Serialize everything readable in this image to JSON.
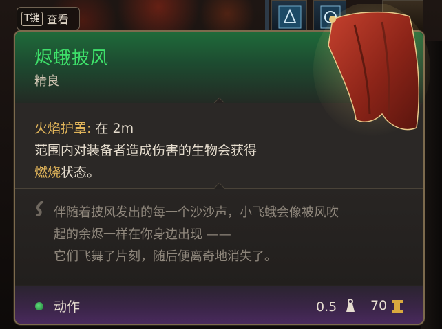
{
  "hotkey": {
    "key": "T键",
    "label": "查看"
  },
  "item": {
    "name": "烬蛾披风",
    "rarity": "精良",
    "property": {
      "name": "火焰护罩:",
      "range": " 在 2m",
      "line2": "范围内对装备者造成伤害的生物会获得",
      "status": "燃烧",
      "line3_rest": "状态。"
    },
    "flavor": [
      "伴随着披风发出的每一个沙沙声，小飞蛾会像被风吹",
      "起的余烬一样在你身边出现 ——",
      "它们飞舞了片刻，随后便离奇地消失了。"
    ],
    "footer": {
      "action": "动作",
      "weight": "0.5",
      "price": "70"
    }
  },
  "colors": {
    "title": "#3ee06a",
    "gold": "#e0b45a",
    "border": "#7c6a4d"
  },
  "icons": [
    "weight-icon",
    "gold-coin-icon",
    "quote-icon",
    "cloak-image"
  ]
}
